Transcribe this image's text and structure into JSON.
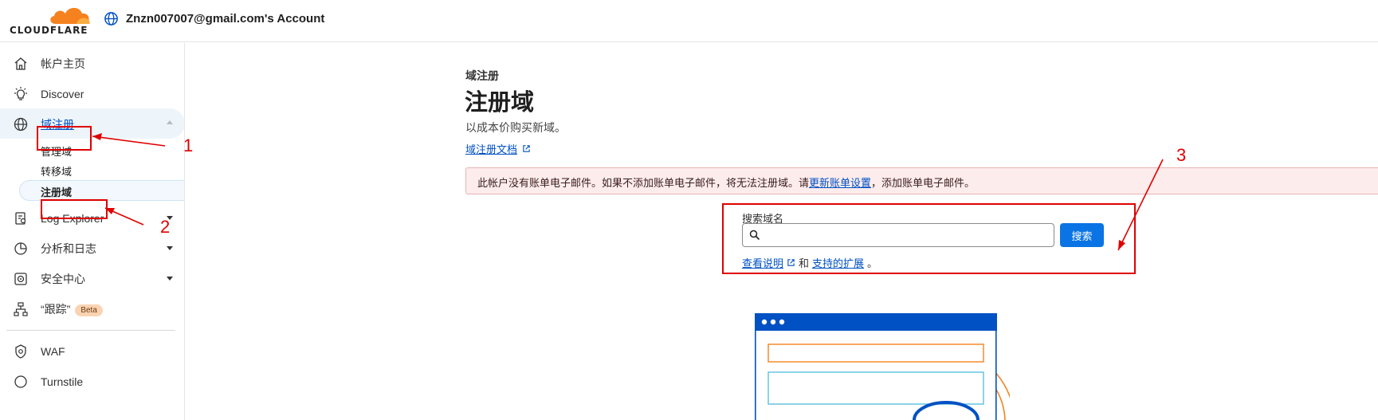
{
  "header": {
    "logo_text": "CLOUDFLARE",
    "account_name": "Znzn007007@gmail.com's Account"
  },
  "sidebar": {
    "items": [
      {
        "label": "帐户主页",
        "icon": "home-icon"
      },
      {
        "label": "Discover",
        "icon": "lightbulb-icon"
      },
      {
        "label": "域注册",
        "icon": "globe-icon"
      },
      {
        "label": "Log Explorer",
        "icon": "log-explorer-icon"
      },
      {
        "label": "分析和日志",
        "icon": "chart-icon"
      },
      {
        "label": "安全中心",
        "icon": "security-center-icon"
      },
      {
        "label": "“跟踪”",
        "icon": "sitemap-icon",
        "badge": "Beta"
      },
      {
        "label": "WAF",
        "icon": "shield-icon"
      },
      {
        "label": "Turnstile",
        "icon": "turnstile-icon"
      }
    ],
    "sub_items": [
      {
        "label": "管理域"
      },
      {
        "label": "转移域"
      },
      {
        "label": "注册域"
      }
    ]
  },
  "main": {
    "breadcrumb": "域注册",
    "title": "注册域",
    "subtitle": "以成本价购买新域。",
    "doc_link": "域注册文档",
    "alert": {
      "text_before": "此帐户没有账单电子邮件。如果不添加账单电子邮件，将无法注册域。请",
      "link": "更新账单设置",
      "text_after": "，添加账单电子邮件。"
    },
    "search": {
      "label": "搜索域名",
      "value": "",
      "placeholder": "",
      "button": "搜索",
      "help_link1": "查看说明",
      "help_and": "和",
      "help_link2": "支持的扩展",
      "help_end": "。"
    }
  },
  "annotations": {
    "n1": "1",
    "n2": "2",
    "n3": "3"
  },
  "colors": {
    "brand_orange": "#f6821f",
    "link_blue": "#0051c3",
    "button_blue": "#0b74e5",
    "annotation_red": "#e00000",
    "alert_bg": "#fdecec"
  }
}
